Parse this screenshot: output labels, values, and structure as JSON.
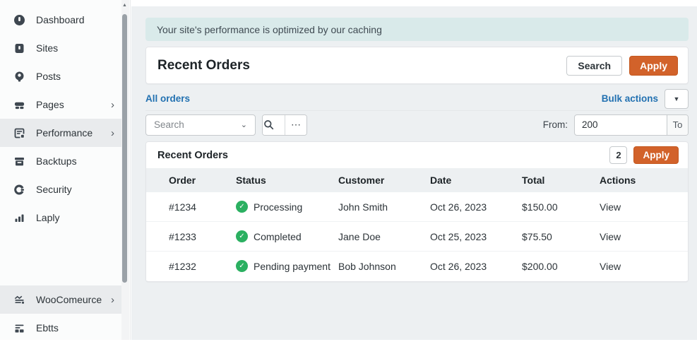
{
  "colors": {
    "accent_orange": "#d2622a",
    "link_blue": "#2271b1",
    "status_green": "#2bb061",
    "banner_bg": "#d9eaea",
    "sidebar_active_bg": "#e9ebed",
    "table_header_bg": "#edf0f2"
  },
  "sidebar": {
    "top_items": [
      {
        "label": "Dashboard",
        "icon": "dashboard-icon",
        "chevron": false,
        "active": false
      },
      {
        "label": "Sites",
        "icon": "sites-icon",
        "chevron": false,
        "active": false
      },
      {
        "label": "Posts",
        "icon": "posts-icon",
        "chevron": false,
        "active": false
      },
      {
        "label": "Pages",
        "icon": "pages-icon",
        "chevron": true,
        "active": false
      },
      {
        "label": "Performance",
        "icon": "performance-icon",
        "chevron": true,
        "active": true
      },
      {
        "label": "Backtups",
        "icon": "backups-icon",
        "chevron": false,
        "active": false
      },
      {
        "label": "Security",
        "icon": "security-icon",
        "chevron": false,
        "active": false
      },
      {
        "label": "Laply",
        "icon": "bar-chart-icon",
        "chevron": false,
        "active": false
      }
    ],
    "bottom_items": [
      {
        "label": "WooComeurce",
        "icon": "woocommerce-icon",
        "chevron": true,
        "active": true
      },
      {
        "label": "Ebtts",
        "icon": "grid-icon",
        "chevron": false,
        "active": false
      }
    ]
  },
  "banner": {
    "text": "Your site's performance is optimized by our caching"
  },
  "header": {
    "title": "Recent Orders",
    "search_label": "Search",
    "apply_label": "Apply"
  },
  "filters": {
    "all_orders_label": "All orders",
    "bulk_actions_label": "Bulk actions",
    "search_placeholder": "Search",
    "from_label": "From:",
    "from_value": "200",
    "to_label": "To"
  },
  "orders_panel": {
    "title": "Recent Orders",
    "count_badge": "2",
    "apply_label": "Apply",
    "columns": [
      "Order",
      "Status",
      "Customer",
      "Date",
      "Total",
      "Actions"
    ],
    "rows": [
      {
        "order": "#1234",
        "status": "Processing",
        "status_icon": "check-circle-icon",
        "customer": "John Smith",
        "date": "Oct 26, 2023",
        "total": "$150.00",
        "action": "View"
      },
      {
        "order": "#1233",
        "status": "Completed",
        "status_icon": "check-circle-icon",
        "customer": "Jane Doe",
        "date": "Oct 25, 2023",
        "total": "$75.50",
        "action": "View"
      },
      {
        "order": "#1232",
        "status": "Pending payment",
        "status_icon": "check-circle-icon",
        "customer": "Bob Johnson",
        "date": "Oct 26, 2023",
        "total": "$200.00",
        "action": "View"
      }
    ]
  }
}
